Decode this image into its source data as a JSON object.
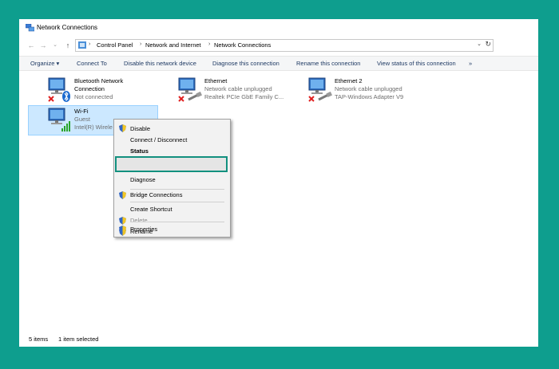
{
  "window": {
    "title": "Network Connections"
  },
  "address": {
    "crumbs": [
      "Control Panel",
      "Network and Internet",
      "Network Connections"
    ]
  },
  "toolbar": {
    "organize": "Organize ▾",
    "connect_to": "Connect To",
    "disable": "Disable this network device",
    "diagnose": "Diagnose this connection",
    "rename": "Rename this connection",
    "view_status": "View status of this connection",
    "more": "»"
  },
  "connections": [
    {
      "name": "Bluetooth Network",
      "name2": "Connection",
      "status": "Not connected",
      "icon": "bluetooth-network-icon"
    },
    {
      "name": "Ethernet",
      "status": "Network cable unplugged",
      "adapter": "Realtek PCIe GbE Family C...",
      "icon": "ethernet-icon"
    },
    {
      "name": "Ethernet 2",
      "status": "Network cable unplugged",
      "adapter": "TAP-Windows Adapter V9",
      "icon": "ethernet-icon"
    },
    {
      "name": "Wi-Fi",
      "status": "Guest",
      "adapter": "Intel(R) Wirele",
      "icon": "wifi-network-icon"
    }
  ],
  "context_menu": {
    "disable": "Disable",
    "connect": "Connect / Disconnect",
    "status": "Status",
    "diagnose": "Diagnose",
    "bridge": "Bridge Connections",
    "shortcut": "Create Shortcut",
    "delete": "Delete",
    "rename": "Rename",
    "properties": "Properties"
  },
  "statusbar": {
    "items": "5 items",
    "selected": "1 item selected"
  },
  "colors": {
    "background": "#0e9e8e",
    "selection": "#cce8ff",
    "highlight_border": "#12907f"
  }
}
